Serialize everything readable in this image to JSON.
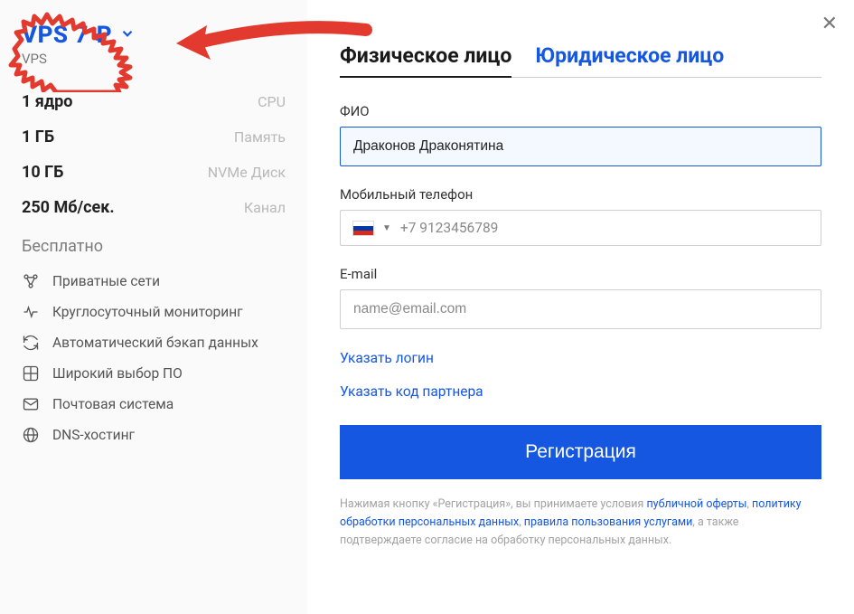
{
  "sidebar": {
    "plan_title": "VPS 7 ₽",
    "plan_sub": "VPS",
    "specs": [
      {
        "value": "1 ядро",
        "label": "CPU"
      },
      {
        "value": "1 ГБ",
        "label": "Память"
      },
      {
        "value": "10 ГБ",
        "label": "NVMe Диск"
      },
      {
        "value": "250 Мб/сек.",
        "label": "Канал"
      }
    ],
    "free_label": "Бесплатно",
    "features": [
      {
        "icon": "network-icon",
        "label": "Приватные сети"
      },
      {
        "icon": "monitor-icon",
        "label": "Круглосуточный мониторинг"
      },
      {
        "icon": "backup-icon",
        "label": "Автоматический бэкап данных"
      },
      {
        "icon": "software-icon",
        "label": "Широкий выбор ПО"
      },
      {
        "icon": "mail-icon",
        "label": "Почтовая система"
      },
      {
        "icon": "dns-icon",
        "label": "DNS-хостинг"
      }
    ]
  },
  "form": {
    "tabs": {
      "individual": "Физическое лицо",
      "legal": "Юридическое лицо"
    },
    "fio_label": "ФИО",
    "fio_value": "Драконов Драконятина",
    "phone_label": "Мобильный телефон",
    "phone_placeholder": "+7 9123456789",
    "email_label": "E-mail",
    "email_placeholder": "name@email.com",
    "login_link": "Указать логин",
    "partner_link": "Указать код партнера",
    "register_btn": "Регистрация",
    "disclaimer": {
      "t1": "Нажимая кнопку «Регистрация», вы принимаете условия ",
      "l1": "публичной оферты",
      "t2": ", ",
      "l2": "политику обработки персональных данных",
      "t3": ", ",
      "l3": "правила пользования услугами",
      "t4": ", а также подтверждаете согласие на обработку персональных данных."
    }
  },
  "colors": {
    "accent": "#1657e2",
    "highlight": "#e23a2e"
  }
}
